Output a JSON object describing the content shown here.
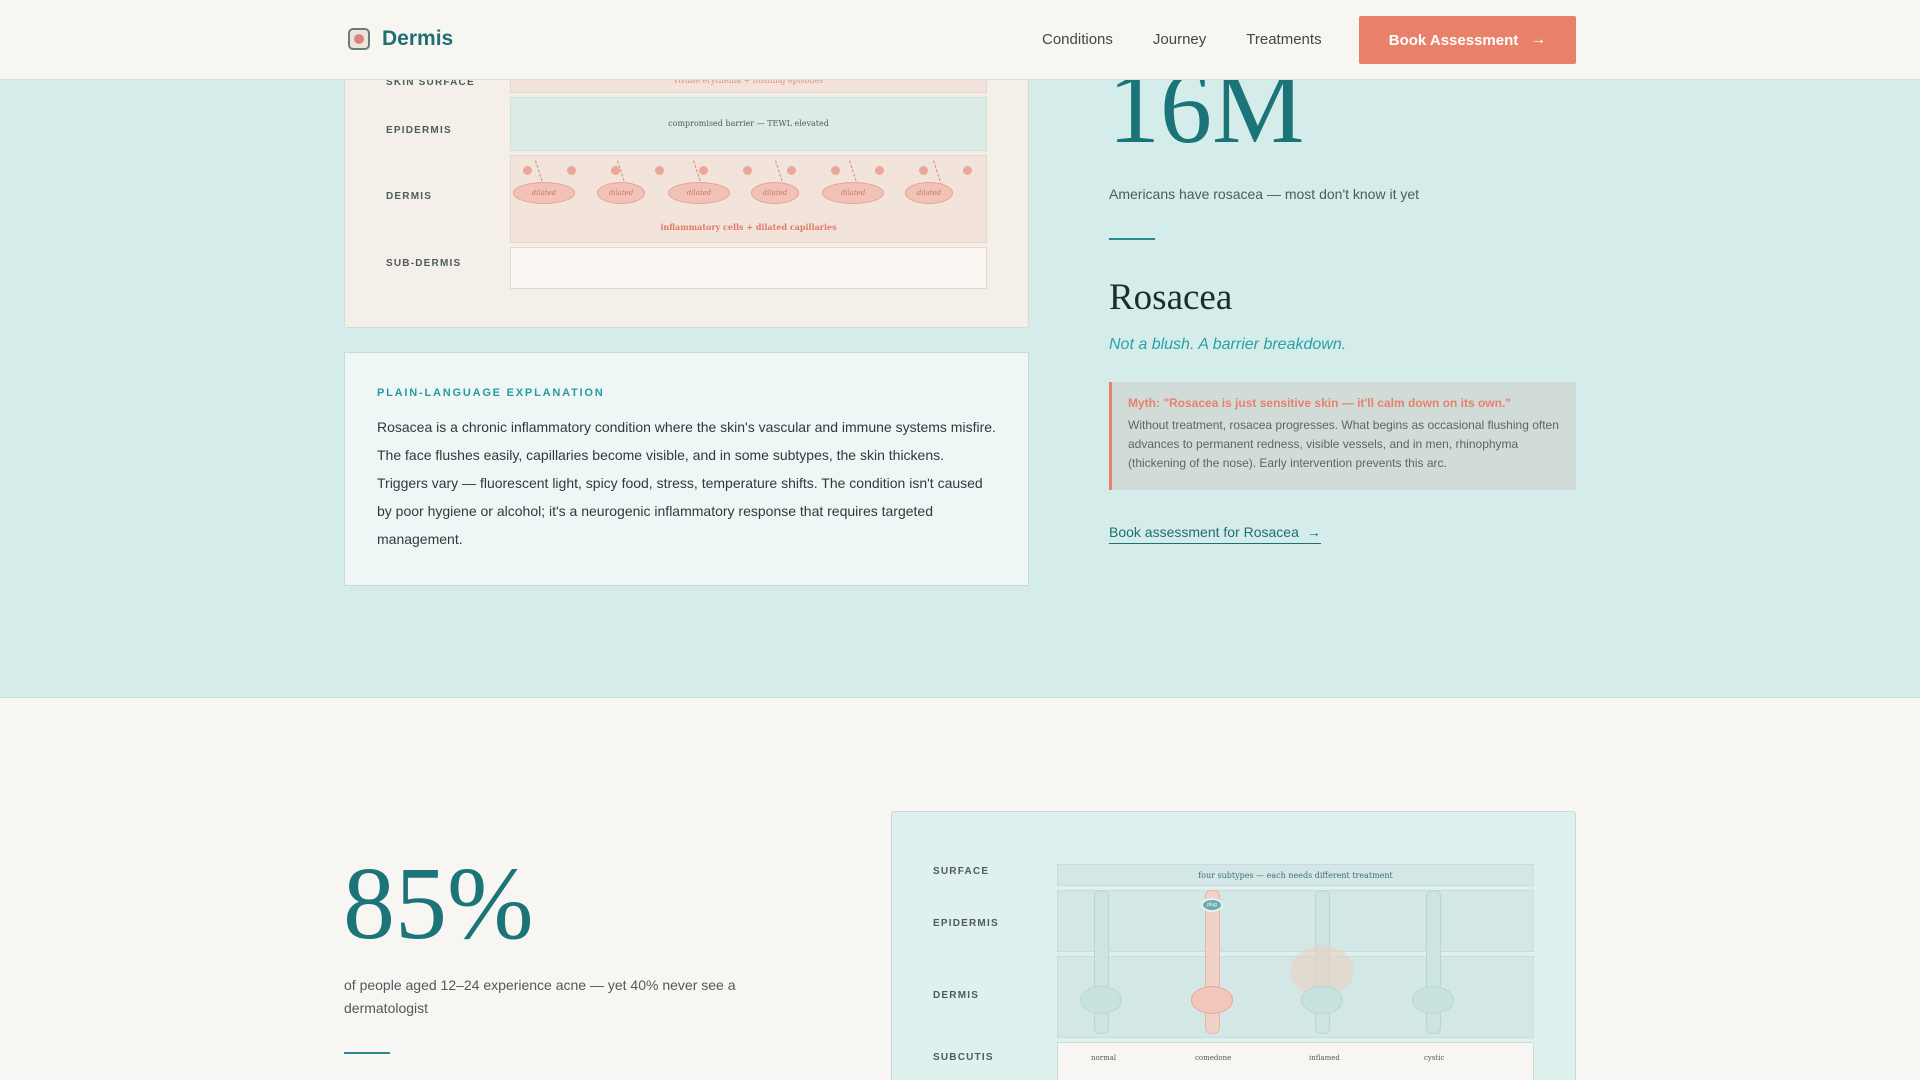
{
  "nav": {
    "brand": "Dermis",
    "links": [
      "Conditions",
      "Journey",
      "Treatments"
    ],
    "cta": "Book Assessment"
  },
  "rosacea": {
    "diagram": {
      "layers": [
        "SKIN SURFACE",
        "EPIDERMIS",
        "DERMIS",
        "SUB-DERMIS"
      ],
      "surface_note": "visible erythema + flushing episodes",
      "epidermis_note": "compromised barrier — TEWL elevated",
      "dermis_note": "inflammatory cells + dilated capillaries",
      "vessel_label": "dilated"
    },
    "explanation": {
      "kicker": "PLAIN-LANGUAGE EXPLANATION",
      "body": "Rosacea is a chronic inflammatory condition where the skin's vascular and immune systems misfire. The face flushes easily, capillaries become visible, and in some subtypes, the skin thickens. Triggers vary — fluorescent light, spicy food, stress, temperature shifts. The condition isn't caused by poor hygiene or alcohol; it's a neurogenic inflammatory response that requires targeted management."
    },
    "stat": "16M",
    "stat_caption": "Americans have rosacea — most don't know it yet",
    "title": "Rosacea",
    "tagline": "Not a blush. A barrier breakdown.",
    "myth": {
      "title": "Myth: \"Rosacea is just sensitive skin — it'll calm down on its own.\"",
      "body": "Without treatment, rosacea progresses. What begins as occasional flushing often advances to permanent redness, visible vessels, and in men, rhinophyma (thickening of the nose). Early intervention prevents this arc."
    },
    "book_link": "Book assessment for Rosacea"
  },
  "acne": {
    "stat": "85%",
    "stat_caption": "of people aged 12–24 experience acne — yet 40% never see a dermatologist",
    "diagram": {
      "layers": [
        "SURFACE",
        "EPIDERMIS",
        "DERMIS",
        "SUBCUTIS"
      ],
      "surface_note": "four subtypes — each needs different treatment",
      "comedo_label": "plug",
      "subtypes": [
        "normal",
        "comedone",
        "inflamed",
        "cystic"
      ]
    }
  }
}
